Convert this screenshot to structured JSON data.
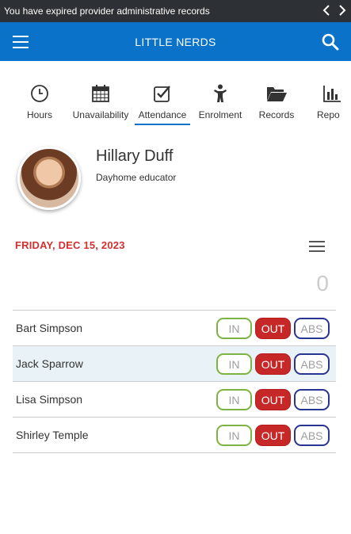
{
  "notice": {
    "text": "You have expired provider administrative records",
    "prev_icon": "chevron-left-icon",
    "next_icon": "chevron-right-icon"
  },
  "appbar": {
    "title": "LITTLE NERDS",
    "menu_icon": "hamburger-icon",
    "search_icon": "search-icon",
    "color": "#0a73c9"
  },
  "tabs": [
    {
      "label": "Hours",
      "icon": "clock-icon"
    },
    {
      "label": "Unavailability",
      "icon": "calendar-icon"
    },
    {
      "label": "Attendance",
      "icon": "checkbox-icon",
      "active": true
    },
    {
      "label": "Enrolment",
      "icon": "child-icon"
    },
    {
      "label": "Records",
      "icon": "folder-icon"
    },
    {
      "label": "Repo",
      "icon": "bar-chart-icon"
    }
  ],
  "profile": {
    "name": "Hillary Duff",
    "role": "Dayhome educator"
  },
  "date": "FRIDAY, DEC 15, 2023",
  "count": "0",
  "buttons": {
    "in": "IN",
    "out": "OUT",
    "abs": "ABS"
  },
  "children": [
    {
      "name": "Bart Simpson"
    },
    {
      "name": "Jack Sparrow"
    },
    {
      "name": "Lisa Simpson"
    },
    {
      "name": "Shirley Temple"
    }
  ],
  "colors": {
    "date_red": "#d32f2f",
    "out_red": "#c62828",
    "in_green": "#7cb342",
    "abs_blue": "#283593",
    "notice_bg": "#2d3034"
  }
}
